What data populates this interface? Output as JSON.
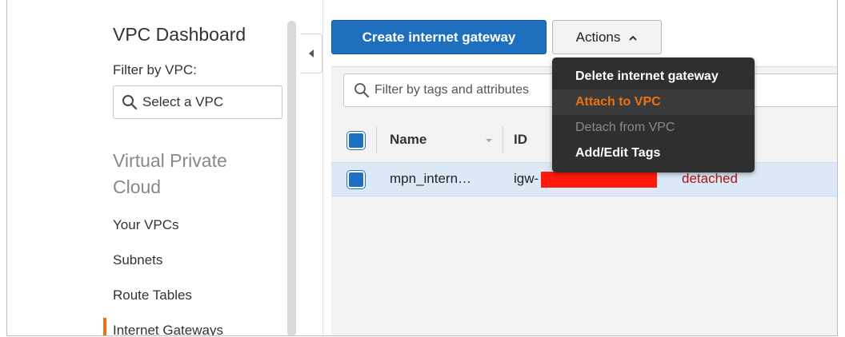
{
  "sidebar": {
    "title": "VPC Dashboard",
    "filter_label": "Filter by VPC:",
    "vpc_select_placeholder": "Select a VPC",
    "section_title": "Virtual Private Cloud",
    "nav_items": [
      {
        "label": "Your VPCs"
      },
      {
        "label": "Subnets"
      },
      {
        "label": "Route Tables"
      },
      {
        "label": "Internet Gateways",
        "active": true
      }
    ]
  },
  "toolbar": {
    "create_label": "Create internet gateway",
    "actions_label": "Actions",
    "actions_icon": "chevron-up-icon"
  },
  "actions_menu": {
    "items": [
      {
        "label": "Delete internet gateway",
        "state": "normal"
      },
      {
        "label": "Attach to VPC",
        "state": "hover"
      },
      {
        "label": "Detach from VPC",
        "state": "disabled"
      },
      {
        "label": "Add/Edit Tags",
        "state": "normal"
      }
    ]
  },
  "search": {
    "placeholder": "Filter by tags and attributes"
  },
  "table": {
    "columns": [
      "Name",
      "ID"
    ],
    "rows": [
      {
        "name": "mpn_intern…",
        "id_prefix": "igw-",
        "status": "detached",
        "selected": true
      }
    ]
  },
  "colors": {
    "primary": "#1f6fbf",
    "active_accent": "#ec7211",
    "status_detached": "#b0121b",
    "redaction": "#ff1a0a"
  }
}
